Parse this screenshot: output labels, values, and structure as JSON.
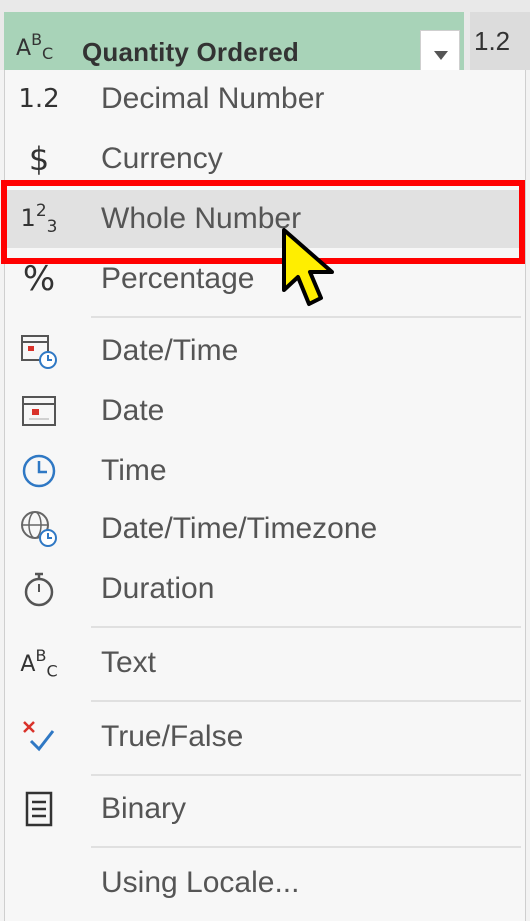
{
  "column_header": {
    "type_icon": "abc-text-type-icon",
    "type_glyph": {
      "a": "A",
      "b": "B",
      "c": "C"
    },
    "title": "Quantity Ordered",
    "next_column_label": "1.2"
  },
  "menu": {
    "items": [
      {
        "label": "Decimal Number",
        "icon": "decimal-icon",
        "glyph": "1.2"
      },
      {
        "label": "Currency",
        "icon": "dollar-icon",
        "glyph": "$"
      },
      {
        "label": "Whole Number",
        "icon": "whole-number-icon",
        "glyph": {
          "a": "1",
          "b": "2",
          "c": "3"
        },
        "highlighted": true
      },
      {
        "label": "Percentage",
        "icon": "percent-icon",
        "glyph": "%"
      },
      {
        "label": "Date/Time",
        "icon": "datetime-icon"
      },
      {
        "label": "Date",
        "icon": "calendar-icon"
      },
      {
        "label": "Time",
        "icon": "clock-icon"
      },
      {
        "label": "Date/Time/Timezone",
        "icon": "globe-clock-icon"
      },
      {
        "label": "Duration",
        "icon": "stopwatch-icon"
      },
      {
        "label": "Text",
        "icon": "abc-text-icon",
        "glyph": {
          "a": "A",
          "b": "B",
          "c": "C"
        }
      },
      {
        "label": "True/False",
        "icon": "true-false-icon"
      },
      {
        "label": "Binary",
        "icon": "binary-document-icon"
      },
      {
        "label": "Using Locale..."
      }
    ]
  },
  "colors": {
    "header_accent": "#a8d3b8",
    "highlight_box": "#ff0000",
    "cursor_fill": "#ffee00",
    "icon_blue": "#2f78c4",
    "icon_red": "#d9322a"
  }
}
